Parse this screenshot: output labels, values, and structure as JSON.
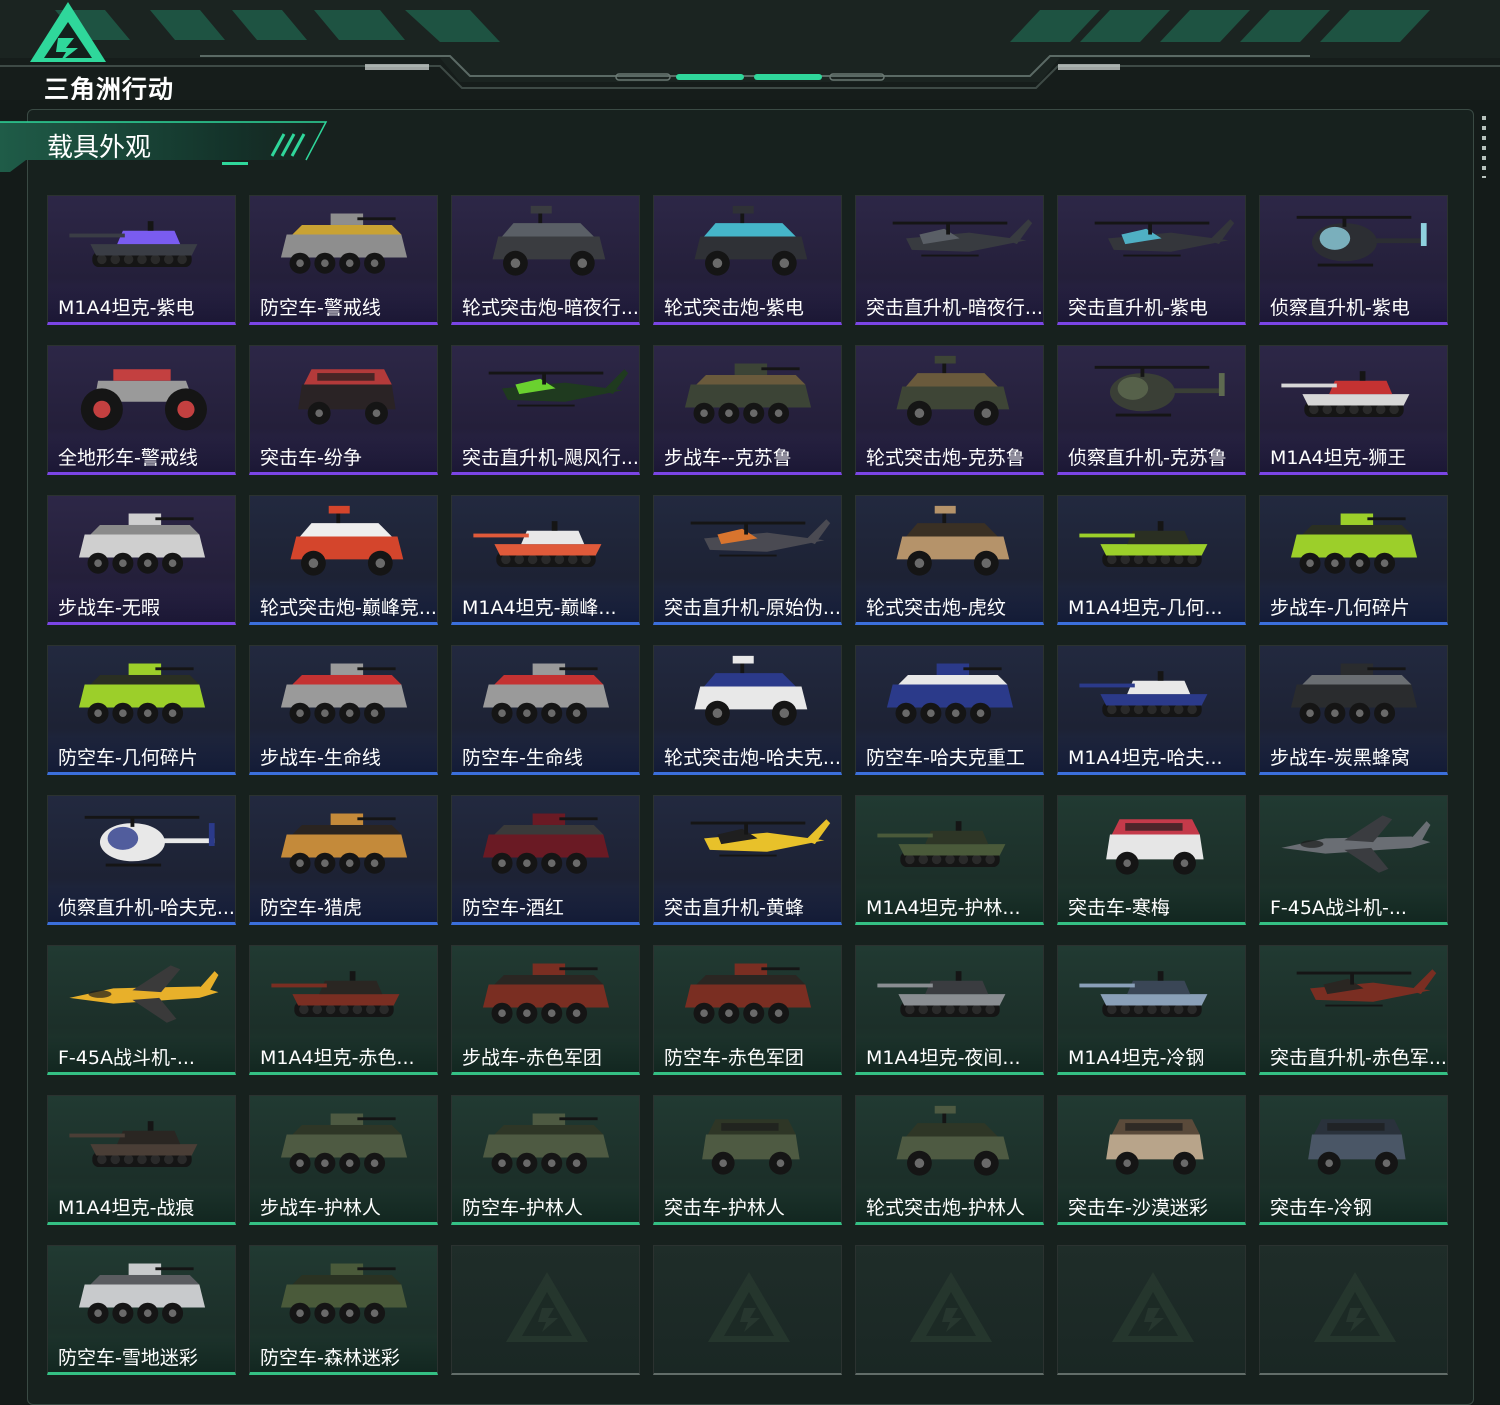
{
  "app": {
    "name": "三角洲行动"
  },
  "section": {
    "title": "载具外观"
  },
  "colors": {
    "accent": "#2fd79b",
    "rarity_purple": "#7b45e6",
    "rarity_blue": "#3b6fdc",
    "rarity_green": "#34c084"
  },
  "cards": [
    {
      "label": "M1A4坦克-紫电",
      "rarity": "purple",
      "vehicle": "tank-icon",
      "colors": [
        "#3a3d45",
        "#7a5cf0"
      ]
    },
    {
      "label": "防空车-警戒线",
      "rarity": "purple",
      "vehicle": "apc-icon",
      "colors": [
        "#8e8e8e",
        "#c9a233"
      ]
    },
    {
      "label": "轮式突击炮-暗夜行...",
      "rarity": "purple",
      "vehicle": "armored-car-icon",
      "colors": [
        "#3a3c40",
        "#5a5f66"
      ]
    },
    {
      "label": "轮式突击炮-紫电",
      "rarity": "purple",
      "vehicle": "armored-car-icon",
      "colors": [
        "#2f3136",
        "#45b5c9"
      ]
    },
    {
      "label": "突击直升机-暗夜行...",
      "rarity": "purple",
      "vehicle": "attack-helicopter-icon",
      "colors": [
        "#383b40",
        "#5a5f66"
      ]
    },
    {
      "label": "突击直升机-紫电",
      "rarity": "purple",
      "vehicle": "attack-helicopter-icon",
      "colors": [
        "#34363b",
        "#4fb0c4"
      ]
    },
    {
      "label": "侦察直升机-紫电",
      "rarity": "purple",
      "vehicle": "scout-helicopter-icon",
      "colors": [
        "#2c2e33",
        "#8fd0de"
      ]
    },
    {
      "label": "全地形车-警戒线",
      "rarity": "purple",
      "vehicle": "atv-icon",
      "colors": [
        "#9a9a9a",
        "#c34040"
      ]
    },
    {
      "label": "突击车-纷争",
      "rarity": "purple",
      "vehicle": "assault-car-icon",
      "colors": [
        "#2a2325",
        "#b33a3a"
      ]
    },
    {
      "label": "突击直升机-飓风行...",
      "rarity": "purple",
      "vehicle": "attack-helicopter-icon",
      "colors": [
        "#1f3a1f",
        "#6ad12f"
      ]
    },
    {
      "label": "步战车--克苏鲁",
      "rarity": "purple",
      "vehicle": "apc-icon",
      "colors": [
        "#3c4436",
        "#6a5a3c"
      ]
    },
    {
      "label": "轮式突击炮-克苏鲁",
      "rarity": "purple",
      "vehicle": "armored-car-icon",
      "colors": [
        "#3e4536",
        "#6a5a3c"
      ]
    },
    {
      "label": "侦察直升机-克苏鲁",
      "rarity": "purple",
      "vehicle": "scout-helicopter-icon",
      "colors": [
        "#3a3f36",
        "#5e6a50"
      ]
    },
    {
      "label": "M1A4坦克-狮王",
      "rarity": "purple",
      "vehicle": "tank-icon",
      "colors": [
        "#d7d7d7",
        "#c43232"
      ]
    },
    {
      "label": "步战车-无暇",
      "rarity": "purple",
      "vehicle": "apc-icon",
      "colors": [
        "#cfcfcf",
        "#8a8a8a"
      ]
    },
    {
      "label": "轮式突击炮-巅峰竞...",
      "rarity": "blue",
      "vehicle": "armored-car-icon",
      "colors": [
        "#d4452c",
        "#eeeeee"
      ]
    },
    {
      "label": "M1A4坦克-巅峰...",
      "rarity": "blue",
      "vehicle": "tank-icon",
      "colors": [
        "#e05a3a",
        "#e8e8e8"
      ]
    },
    {
      "label": "突击直升机-原始伪...",
      "rarity": "blue",
      "vehicle": "attack-helicopter-icon",
      "colors": [
        "#4a4a52",
        "#d8742e"
      ]
    },
    {
      "label": "轮式突击炮-虎纹",
      "rarity": "blue",
      "vehicle": "armored-car-icon",
      "colors": [
        "#b5936a",
        "#3a3024"
      ]
    },
    {
      "label": "M1A4坦克-几何...",
      "rarity": "blue",
      "vehicle": "tank-icon",
      "colors": [
        "#9ccf2a",
        "#2a2f22"
      ]
    },
    {
      "label": "步战车-几何碎片",
      "rarity": "blue",
      "vehicle": "apc-icon",
      "colors": [
        "#9ccf2a",
        "#2a2f22"
      ]
    },
    {
      "label": "防空车-几何碎片",
      "rarity": "blue",
      "vehicle": "apc-icon",
      "colors": [
        "#9ccf2a",
        "#2a2f22"
      ]
    },
    {
      "label": "步战车-生命线",
      "rarity": "blue",
      "vehicle": "apc-icon",
      "colors": [
        "#9a9a9a",
        "#c43232"
      ]
    },
    {
      "label": "防空车-生命线",
      "rarity": "blue",
      "vehicle": "apc-icon",
      "colors": [
        "#9a9a9a",
        "#c43232"
      ]
    },
    {
      "label": "轮式突击炮-哈夫克...",
      "rarity": "blue",
      "vehicle": "armored-car-icon",
      "colors": [
        "#e8e8e8",
        "#2b3a8a"
      ]
    },
    {
      "label": "防空车-哈夫克重工",
      "rarity": "blue",
      "vehicle": "apc-icon",
      "colors": [
        "#2b3a8a",
        "#e8e8e8"
      ]
    },
    {
      "label": "M1A4坦克-哈夫...",
      "rarity": "blue",
      "vehicle": "tank-icon",
      "colors": [
        "#2b3a8a",
        "#e8e8e8"
      ]
    },
    {
      "label": "步战车-炭黑蜂窝",
      "rarity": "blue",
      "vehicle": "apc-icon",
      "colors": [
        "#2a2c2e",
        "#6a6e72"
      ]
    },
    {
      "label": "侦察直升机-哈夫克...",
      "rarity": "blue",
      "vehicle": "scout-helicopter-icon",
      "colors": [
        "#e8e8e8",
        "#2b3a8a"
      ]
    },
    {
      "label": "防空车-猎虎",
      "rarity": "blue",
      "vehicle": "apc-icon",
      "colors": [
        "#c48a3a",
        "#2a2420"
      ]
    },
    {
      "label": "防空车-酒红",
      "rarity": "blue",
      "vehicle": "apc-icon",
      "colors": [
        "#6a1a24",
        "#3a3a3a"
      ]
    },
    {
      "label": "突击直升机-黄蜂",
      "rarity": "blue",
      "vehicle": "attack-helicopter-icon",
      "colors": [
        "#e8c12a",
        "#1f1f1f"
      ]
    },
    {
      "label": "M1A4坦克-护林...",
      "rarity": "green",
      "vehicle": "tank-icon",
      "colors": [
        "#4a5a3a",
        "#2e3626"
      ]
    },
    {
      "label": "突击车-寒梅",
      "rarity": "green",
      "vehicle": "assault-car-icon",
      "colors": [
        "#e6e6e6",
        "#c43a4a"
      ]
    },
    {
      "label": "F-45A战斗机-...",
      "rarity": "green",
      "vehicle": "fighter-jet-icon",
      "colors": [
        "#6a6e74",
        "#3a3c40"
      ]
    },
    {
      "label": "F-45A战斗机-...",
      "rarity": "green",
      "vehicle": "fighter-jet-icon",
      "colors": [
        "#e8b02a",
        "#3a3a3a"
      ]
    },
    {
      "label": "M1A4坦克-赤色...",
      "rarity": "green",
      "vehicle": "tank-icon",
      "colors": [
        "#7a2e22",
        "#2a2622"
      ]
    },
    {
      "label": "步战车-赤色军团",
      "rarity": "green",
      "vehicle": "apc-icon",
      "colors": [
        "#7a2e22",
        "#2a2622"
      ]
    },
    {
      "label": "防空车-赤色军团",
      "rarity": "green",
      "vehicle": "apc-icon",
      "colors": [
        "#7a2e22",
        "#2a2622"
      ]
    },
    {
      "label": "M1A4坦克-夜间...",
      "rarity": "green",
      "vehicle": "tank-icon",
      "colors": [
        "#8a8e92",
        "#3a3c40"
      ]
    },
    {
      "label": "M1A4坦克-冷钢",
      "rarity": "green",
      "vehicle": "tank-icon",
      "colors": [
        "#8aa0b8",
        "#3a4656"
      ]
    },
    {
      "label": "突击直升机-赤色军...",
      "rarity": "green",
      "vehicle": "attack-helicopter-icon",
      "colors": [
        "#7a2e22",
        "#2a2622"
      ]
    },
    {
      "label": "M1A4坦克-战痕",
      "rarity": "green",
      "vehicle": "tank-icon",
      "colors": [
        "#4a3e36",
        "#2a2622"
      ]
    },
    {
      "label": "步战车-护林人",
      "rarity": "green",
      "vehicle": "apc-icon",
      "colors": [
        "#4e5a42",
        "#2e3626"
      ]
    },
    {
      "label": "防空车-护林人",
      "rarity": "green",
      "vehicle": "apc-icon",
      "colors": [
        "#4e5a42",
        "#2e3626"
      ]
    },
    {
      "label": "突击车-护林人",
      "rarity": "green",
      "vehicle": "assault-car-icon",
      "colors": [
        "#4e5a42",
        "#2e3626"
      ]
    },
    {
      "label": "轮式突击炮-护林人",
      "rarity": "green",
      "vehicle": "armored-car-icon",
      "colors": [
        "#4e5a42",
        "#2e3626"
      ]
    },
    {
      "label": "突击车-沙漠迷彩",
      "rarity": "green",
      "vehicle": "assault-car-icon",
      "colors": [
        "#b8a48a",
        "#5a4a3a"
      ]
    },
    {
      "label": "突击车-冷钢",
      "rarity": "green",
      "vehicle": "assault-car-icon",
      "colors": [
        "#4a5666",
        "#2a323c"
      ]
    },
    {
      "label": "防空车-雪地迷彩",
      "rarity": "green",
      "vehicle": "apc-icon",
      "colors": [
        "#c8cacc",
        "#5a5c60"
      ]
    },
    {
      "label": "防空车-森林迷彩",
      "rarity": "green",
      "vehicle": "apc-icon",
      "colors": [
        "#4a5a3a",
        "#2a3222"
      ]
    },
    {
      "label": "",
      "rarity": "empty",
      "vehicle": "delta-logo-icon",
      "colors": []
    },
    {
      "label": "",
      "rarity": "empty",
      "vehicle": "delta-logo-icon",
      "colors": []
    },
    {
      "label": "",
      "rarity": "empty",
      "vehicle": "delta-logo-icon",
      "colors": []
    },
    {
      "label": "",
      "rarity": "empty",
      "vehicle": "delta-logo-icon",
      "colors": []
    },
    {
      "label": "",
      "rarity": "empty",
      "vehicle": "delta-logo-icon",
      "colors": []
    }
  ]
}
